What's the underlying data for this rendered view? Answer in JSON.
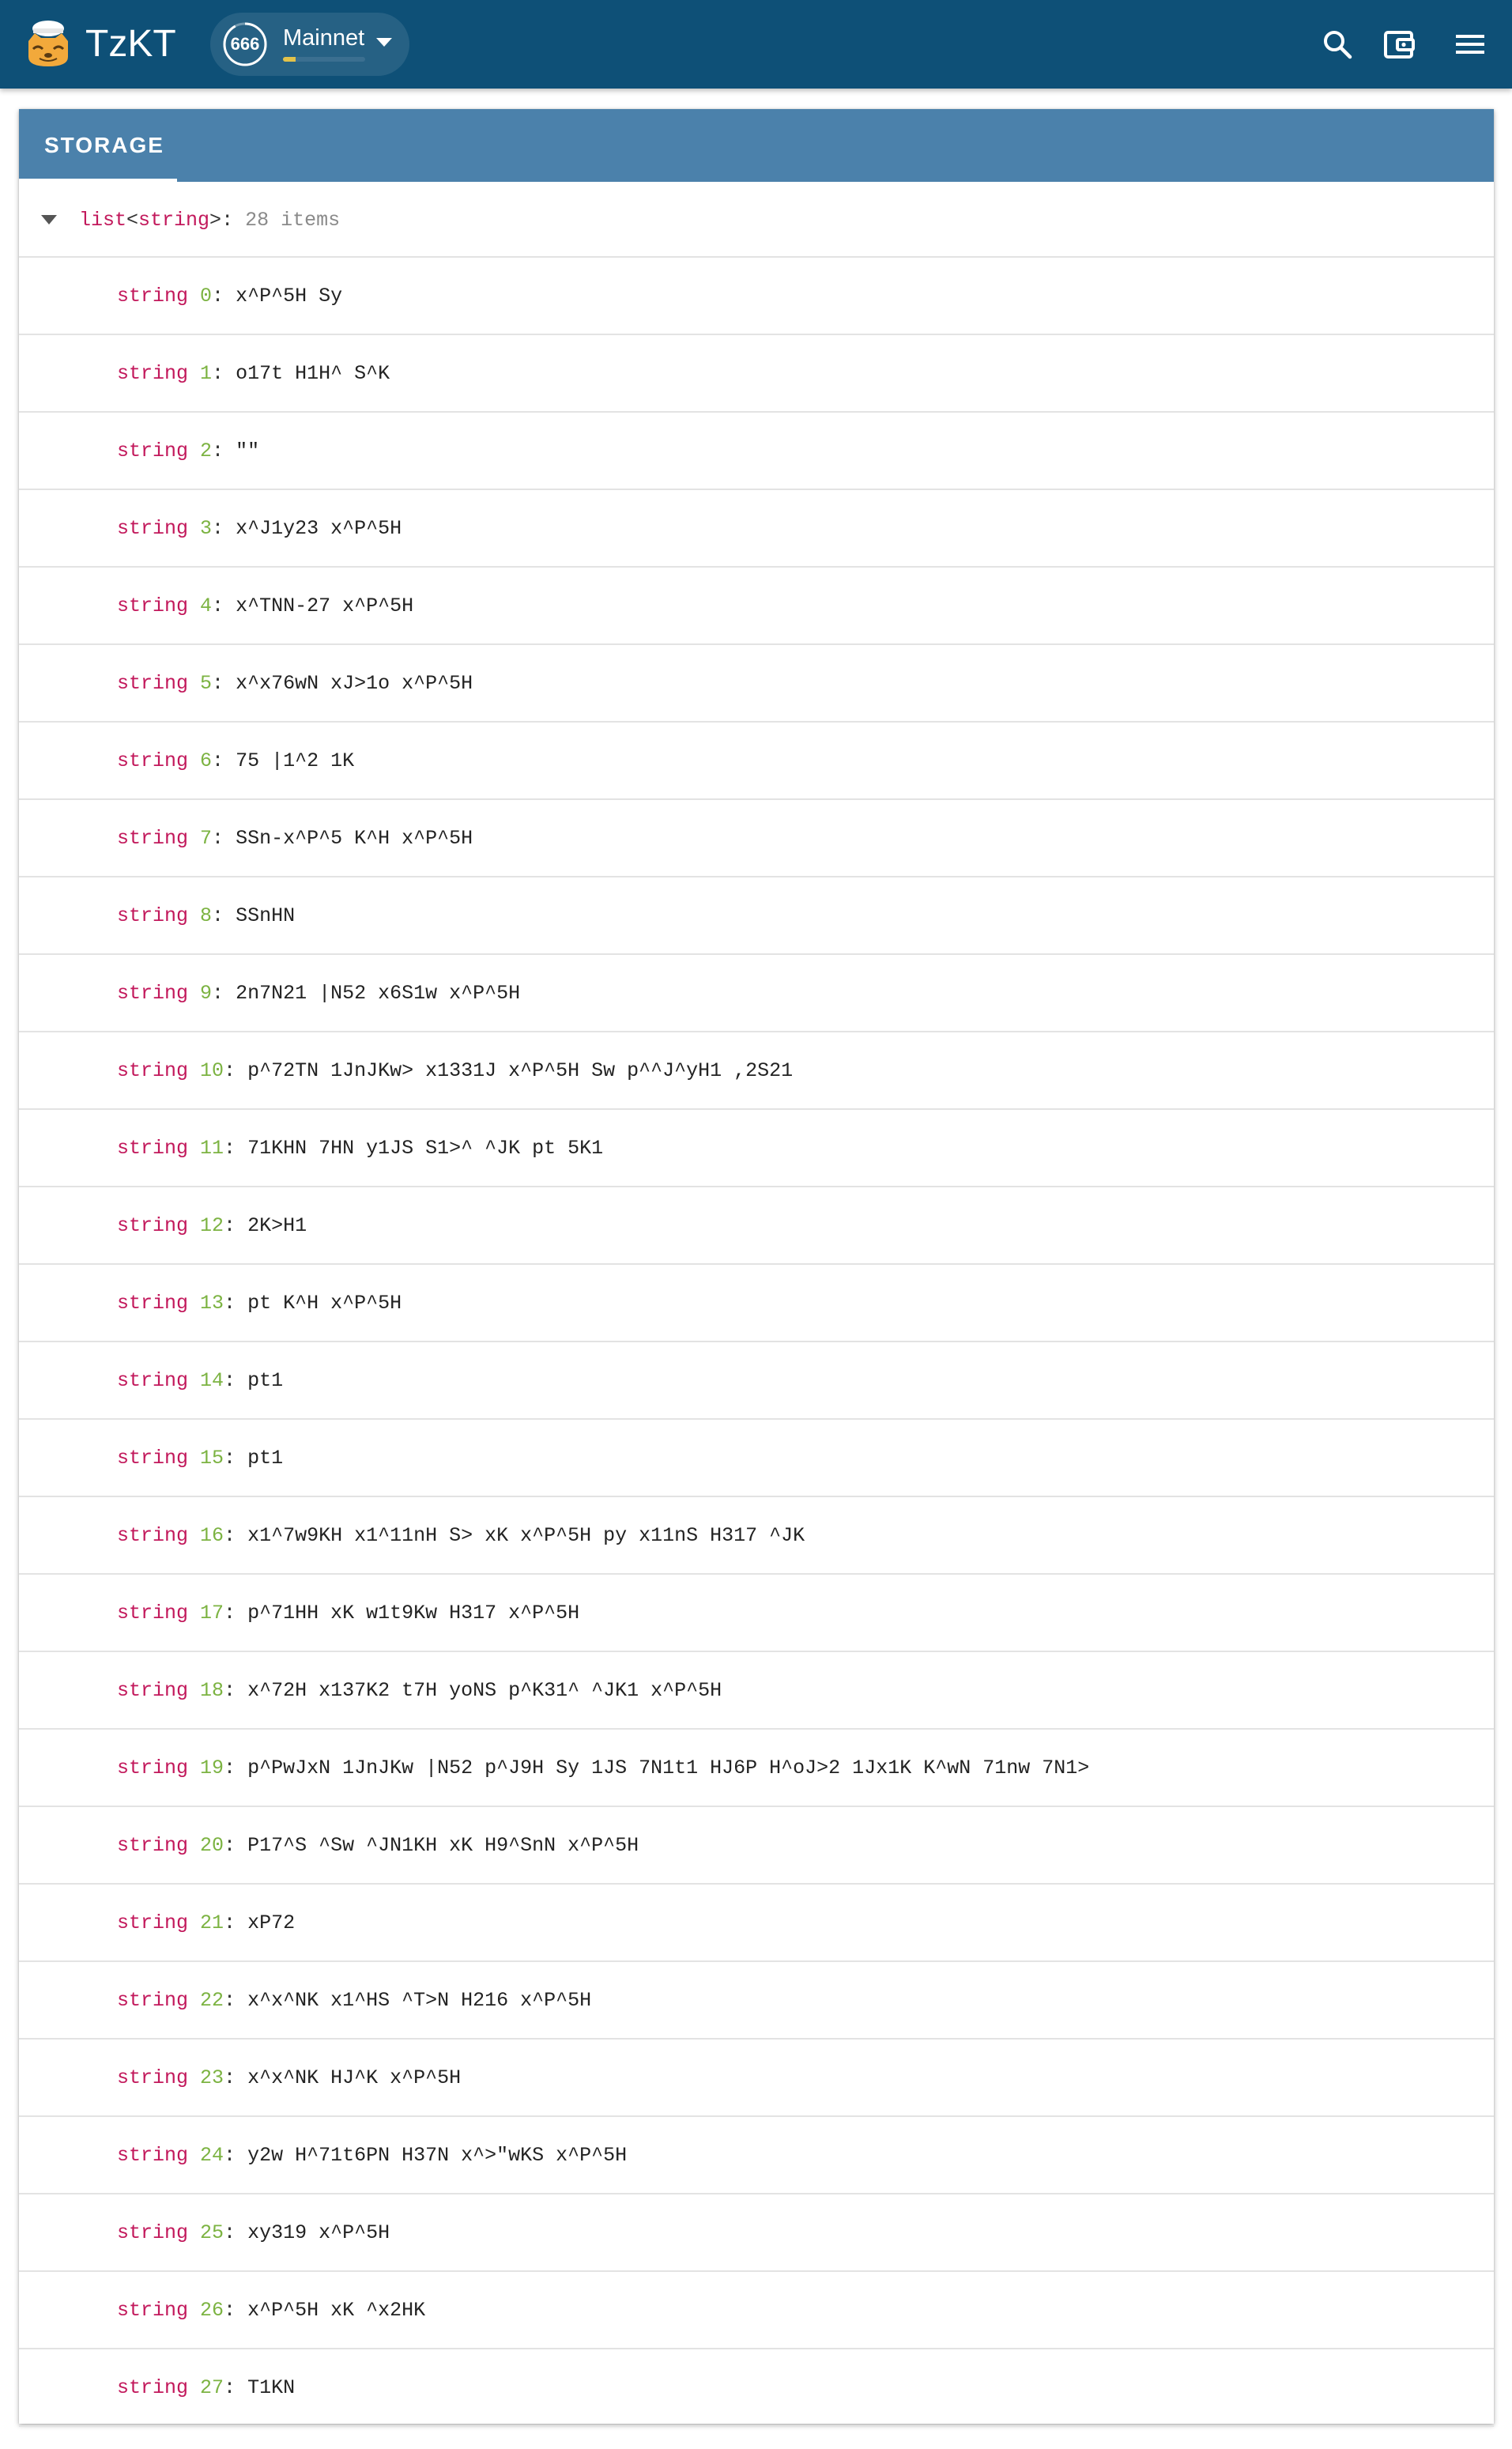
{
  "app": {
    "brand": "TzKT",
    "network": {
      "name": "Mainnet",
      "level": "666",
      "progress": 0.15,
      "ring_color": "#ffffff",
      "bar_color": "#e2c24a"
    },
    "actions": [
      {
        "icon": "search-icon"
      },
      {
        "icon": "wallet-icon"
      },
      {
        "icon": "menu-icon"
      }
    ],
    "colors": {
      "appbar": "#0e5077",
      "tabbar": "#4b81ab",
      "type": "#c2185b",
      "index": "#7cb342"
    }
  },
  "storage": {
    "tab_label": "STORAGE",
    "root": {
      "type_outer": "list",
      "open": "<",
      "type_inner": "string",
      "close": ">",
      "colon": ": ",
      "count": "28 items"
    },
    "entries": [
      {
        "type": "string",
        "index": "0",
        "value": "x^P^5H Sy"
      },
      {
        "type": "string",
        "index": "1",
        "value": "o17t H1H^ S^K"
      },
      {
        "type": "string",
        "index": "2",
        "value": "\"\""
      },
      {
        "type": "string",
        "index": "3",
        "value": "x^J1y23 x^P^5H"
      },
      {
        "type": "string",
        "index": "4",
        "value": "x^TNN-27 x^P^5H"
      },
      {
        "type": "string",
        "index": "5",
        "value": "x^x76wN xJ>1o x^P^5H"
      },
      {
        "type": "string",
        "index": "6",
        "value": "75 |1^2 1K"
      },
      {
        "type": "string",
        "index": "7",
        "value": "SSn-x^P^5 K^H x^P^5H"
      },
      {
        "type": "string",
        "index": "8",
        "value": "SSnHN"
      },
      {
        "type": "string",
        "index": "9",
        "value": "2n7N21 |N52 x6S1w x^P^5H"
      },
      {
        "type": "string",
        "index": "10",
        "value": "p^72TN 1JnJKw> x1331J x^P^5H Sw p^^J^yH1 ,2S21"
      },
      {
        "type": "string",
        "index": "11",
        "value": "71KHN 7HN y1JS S1>^ ^JK pt 5K1"
      },
      {
        "type": "string",
        "index": "12",
        "value": "2K>H1"
      },
      {
        "type": "string",
        "index": "13",
        "value": "pt K^H x^P^5H"
      },
      {
        "type": "string",
        "index": "14",
        "value": "pt1"
      },
      {
        "type": "string",
        "index": "15",
        "value": "pt1"
      },
      {
        "type": "string",
        "index": "16",
        "value": "x1^7w9KH x1^11nH S> xK x^P^5H py x11nS H317 ^JK"
      },
      {
        "type": "string",
        "index": "17",
        "value": "p^71HH xK w1t9Kw H317 x^P^5H"
      },
      {
        "type": "string",
        "index": "18",
        "value": "x^72H x137K2 t7H yoNS p^K31^ ^JK1 x^P^5H"
      },
      {
        "type": "string",
        "index": "19",
        "value": "p^PwJxN 1JnJKw |N52 p^J9H Sy 1JS 7N1t1 HJ6P H^oJ>2 1Jx1K K^wN 71nw 7N1>"
      },
      {
        "type": "string",
        "index": "20",
        "value": "P17^S ^Sw ^JN1KH xK H9^SnN x^P^5H"
      },
      {
        "type": "string",
        "index": "21",
        "value": "xP72"
      },
      {
        "type": "string",
        "index": "22",
        "value": "x^x^NK x1^HS ^T>N H216 x^P^5H"
      },
      {
        "type": "string",
        "index": "23",
        "value": "x^x^NK HJ^K x^P^5H"
      },
      {
        "type": "string",
        "index": "24",
        "value": "y2w H^71t6PN H37N x^>\"wKS x^P^5H"
      },
      {
        "type": "string",
        "index": "25",
        "value": "xy319 x^P^5H"
      },
      {
        "type": "string",
        "index": "26",
        "value": "x^P^5H xK ^x2HK"
      },
      {
        "type": "string",
        "index": "27",
        "value": "T1KN"
      }
    ]
  }
}
